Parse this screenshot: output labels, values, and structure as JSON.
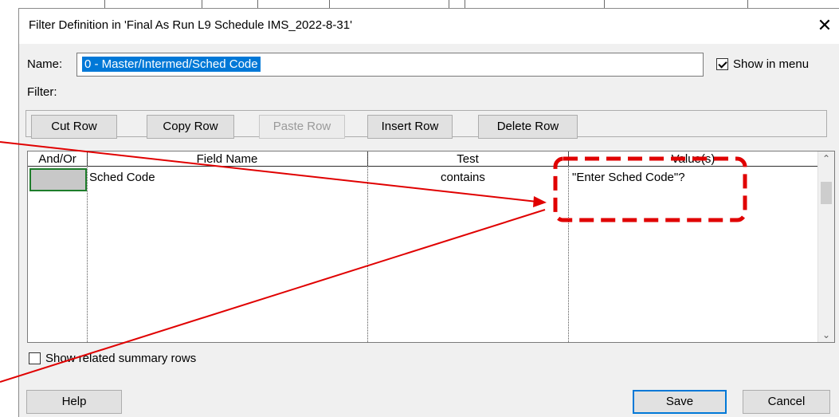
{
  "dialog": {
    "title": "Filter Definition in 'Final As Run L9 Schedule IMS_2022-8-31'",
    "close_label": "✕"
  },
  "name_field": {
    "label": "Name:",
    "value": "0 - Master/Intermed/Sched Code"
  },
  "show_in_menu": {
    "label": "Show in menu",
    "checked": true
  },
  "filter_label": "Filter:",
  "toolbar": {
    "cut_row": "Cut Row",
    "copy_row": "Copy Row",
    "paste_row": "Paste Row",
    "insert_row": "Insert Row",
    "delete_row": "Delete Row"
  },
  "grid": {
    "columns": [
      "And/Or",
      "Field Name",
      "Test",
      "Value(s)"
    ],
    "rows": [
      {
        "and_or": "",
        "field_name": "Sched Code",
        "test": "contains",
        "values": "\"Enter Sched Code\"?"
      }
    ]
  },
  "show_related_summary": {
    "label": "Show related summary rows",
    "checked": false
  },
  "footer": {
    "help": "Help",
    "save": "Save",
    "cancel": "Cancel"
  },
  "annotation_color": "#e00000"
}
